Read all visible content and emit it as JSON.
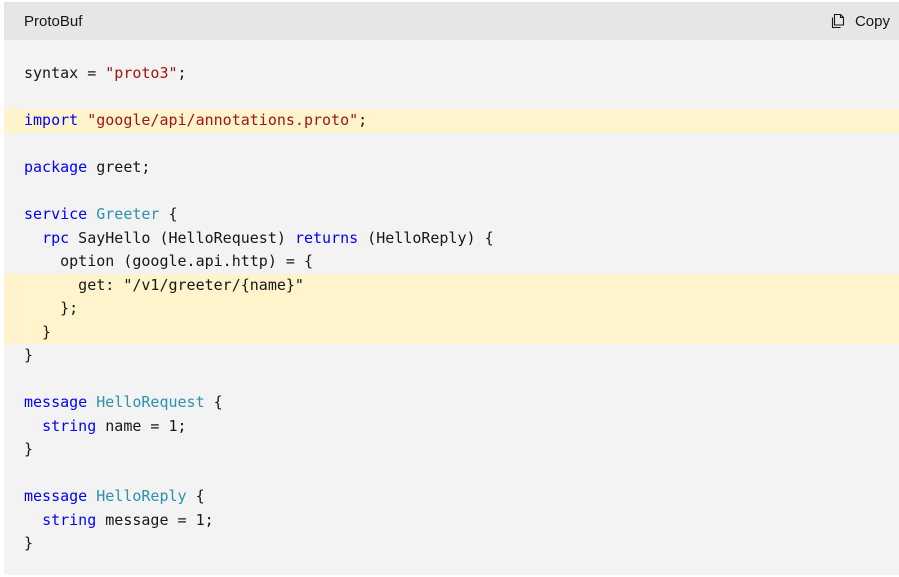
{
  "header": {
    "language": "ProtoBuf",
    "copy_label": "Copy",
    "copy_icon": "copy-icon"
  },
  "colors": {
    "keyword": "#0101fd",
    "type": "#2b91af",
    "string": "#a31515",
    "highlight": "#fff4cc",
    "background": "#f3f3f3",
    "header_background": "#e6e6e6"
  },
  "code": {
    "highlighted_lines": [
      3,
      10,
      11,
      12
    ],
    "lines": [
      [
        {
          "t": "syntax = "
        },
        {
          "t": "\"proto3\"",
          "c": "str"
        },
        {
          "t": ";"
        }
      ],
      [],
      [
        {
          "t": "import",
          "c": "kw"
        },
        {
          "t": " "
        },
        {
          "t": "\"google/api/annotations.proto\"",
          "c": "str"
        },
        {
          "t": ";"
        }
      ],
      [],
      [
        {
          "t": "package",
          "c": "kw"
        },
        {
          "t": " greet;"
        }
      ],
      [],
      [
        {
          "t": "service",
          "c": "kw"
        },
        {
          "t": " "
        },
        {
          "t": "Greeter",
          "c": "ty"
        },
        {
          "t": " {"
        }
      ],
      [
        {
          "t": "  "
        },
        {
          "t": "rpc",
          "c": "kw"
        },
        {
          "t": " SayHello (HelloRequest) "
        },
        {
          "t": "returns",
          "c": "kw"
        },
        {
          "t": " (HelloReply) {"
        }
      ],
      [
        {
          "t": "    option (google.api.http) = {"
        }
      ],
      [
        {
          "t": "      get: \"/v1/greeter/{name}\""
        }
      ],
      [
        {
          "t": "    };"
        }
      ],
      [
        {
          "t": "  }"
        }
      ],
      [
        {
          "t": "}"
        }
      ],
      [],
      [
        {
          "t": "message",
          "c": "kw"
        },
        {
          "t": " "
        },
        {
          "t": "HelloRequest",
          "c": "ty"
        },
        {
          "t": " {"
        }
      ],
      [
        {
          "t": "  "
        },
        {
          "t": "string",
          "c": "kw"
        },
        {
          "t": " name = 1;"
        }
      ],
      [
        {
          "t": "}"
        }
      ],
      [],
      [
        {
          "t": "message",
          "c": "kw"
        },
        {
          "t": " "
        },
        {
          "t": "HelloReply",
          "c": "ty"
        },
        {
          "t": " {"
        }
      ],
      [
        {
          "t": "  "
        },
        {
          "t": "string",
          "c": "kw"
        },
        {
          "t": " message = 1;"
        }
      ],
      [
        {
          "t": "}"
        }
      ]
    ]
  }
}
